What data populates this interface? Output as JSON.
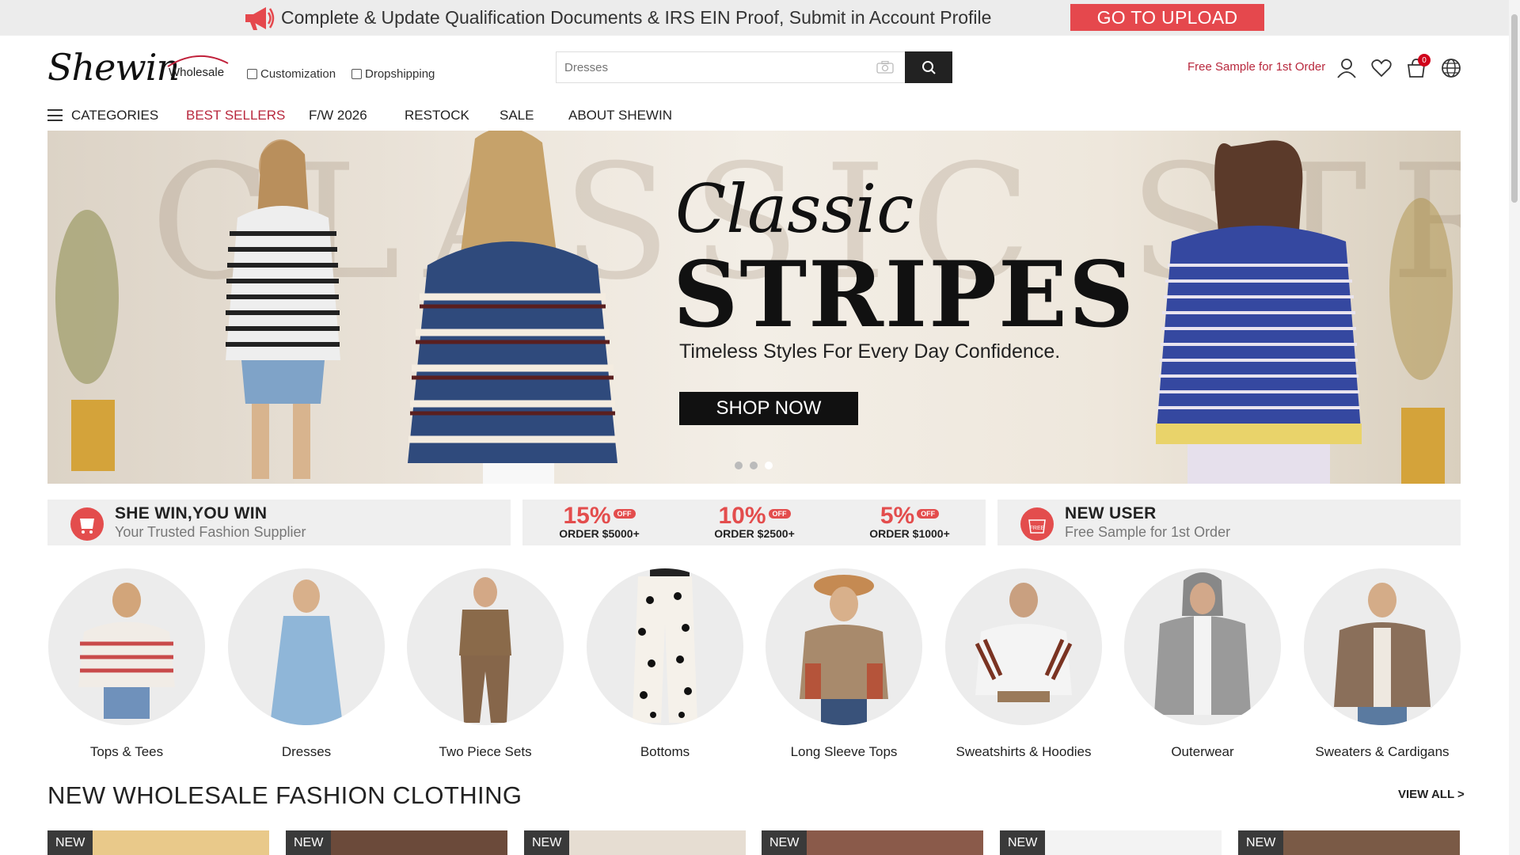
{
  "announcement": {
    "message": "Complete & Update Qualification Documents & IRS EIN Proof, Submit in Account Profile",
    "button": "GO TO UPLOAD"
  },
  "header": {
    "logo_script": "Shewin",
    "logo_sub": "Wholesale",
    "links": [
      "Customization",
      "Dropshipping"
    ],
    "search_placeholder": "Dresses",
    "free_sample": "Free Sample for 1st Order",
    "cart_count": "0"
  },
  "nav": {
    "categories": "CATEGORIES",
    "items": [
      "BEST SELLERS",
      "F/W 2026",
      "RESTOCK",
      "SALE",
      "ABOUT SHEWIN"
    ]
  },
  "hero": {
    "bg_word": "CLASSIC STRIPES",
    "title_script": "Classic",
    "title_main": "STRIPES",
    "tagline": "Timeless Styles For Every Day Confidence.",
    "cta": "SHOP NOW",
    "slide_count": 3,
    "active_slide": 3
  },
  "promo": {
    "left": {
      "title": "SHE WIN,YOU WIN",
      "subtitle": "Your Trusted Fashion Supplier"
    },
    "discounts": [
      {
        "pct": "15%",
        "off": "OFF",
        "order": "ORDER $5000+"
      },
      {
        "pct": "10%",
        "off": "OFF",
        "order": "ORDER $2500+"
      },
      {
        "pct": "5%",
        "off": "OFF",
        "order": "ORDER $1000+"
      }
    ],
    "right": {
      "badge": "FREE",
      "title": "NEW USER",
      "subtitle": "Free Sample for 1st Order"
    }
  },
  "categories": [
    "Tops & Tees",
    "Dresses",
    "Two Piece Sets",
    "Bottoms",
    "Long Sleeve Tops",
    "Sweatshirts & Hoodies",
    "Outerwear",
    "Sweaters & Cardigans"
  ],
  "new_section": {
    "title": "NEW WHOLESALE FASHION CLOTHING",
    "view_all": "VIEW ALL >",
    "badge": "NEW",
    "count": 6
  },
  "colors": {
    "accent": "#e5484d",
    "brand_red": "#b8283d",
    "dark": "#222222"
  }
}
